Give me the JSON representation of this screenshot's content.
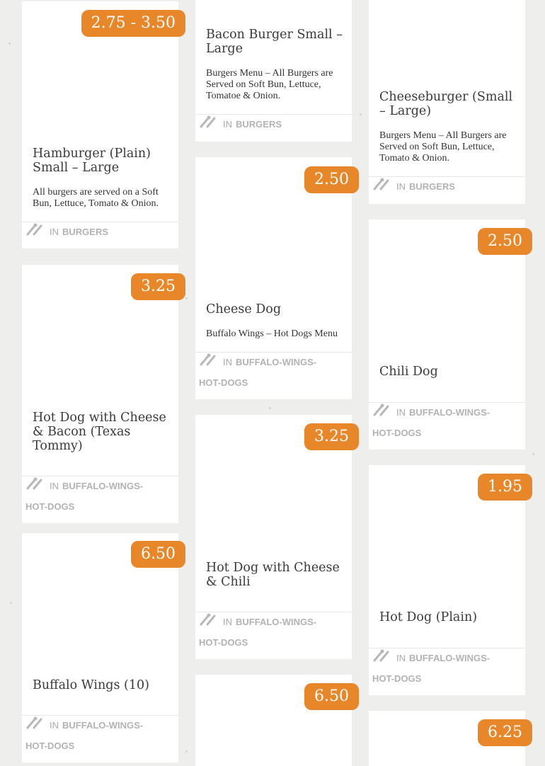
{
  "label_in": "IN",
  "colors": {
    "price_badge": "#e8872a",
    "background": "#eeeeec",
    "card": "#ffffff"
  },
  "items": [
    {
      "title": "Hamburger (Plain) Small – Large",
      "description": "All burgers are served on a Soft Bun, Lettuce, Tomato & Onion.",
      "price": "2.75 - 3.50",
      "category": "BURGERS"
    },
    {
      "title": "Bacon Burger Small – Large",
      "description": "Burgers Menu – All Burgers are Served on Soft Bun, Lettuce, Tomatoe & Onion.",
      "category": "BURGERS"
    },
    {
      "title": "Cheeseburger (Small – Large)",
      "description": "Burgers Menu – All Burgers are Served on Soft Bun, Lettuce, Tomato & Onion.",
      "category": "BURGERS"
    },
    {
      "title": "Cheese Dog",
      "description": "Buffalo Wings – Hot Dogs Menu",
      "price": "2.50",
      "category": "BUFFALO-WINGS-HOT-DOGS"
    },
    {
      "title": "Hot Dog with Cheese & Bacon (Texas Tommy)",
      "price": "3.25",
      "category": "BUFFALO-WINGS-HOT-DOGS"
    },
    {
      "title": "Chili Dog",
      "price": "2.50",
      "category": "BUFFALO-WINGS-HOT-DOGS"
    },
    {
      "title": "Hot Dog with Cheese & Chili",
      "price": "3.25",
      "category": "BUFFALO-WINGS-HOT-DOGS"
    },
    {
      "title": "Hot Dog (Plain)",
      "price": "1.95",
      "category": "BUFFALO-WINGS-HOT-DOGS"
    },
    {
      "title": "Buffalo Wings (10)",
      "price": "6.50",
      "category": "BUFFALO-WINGS-HOT-DOGS"
    },
    {
      "price": "6.50"
    },
    {
      "price": "6.25"
    }
  ]
}
